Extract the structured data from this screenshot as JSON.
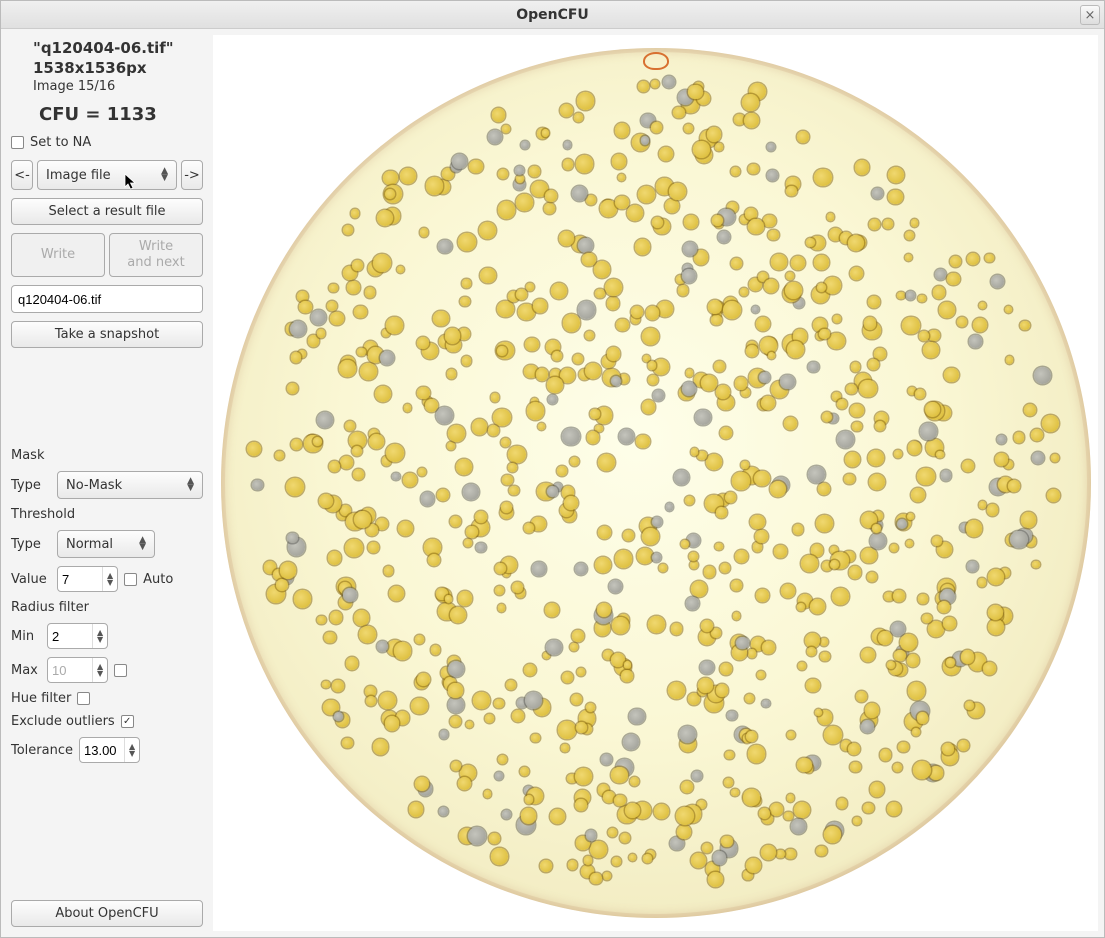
{
  "window": {
    "title": "OpenCFU",
    "close_icon": "×"
  },
  "info": {
    "filename": "\"q120404-06.tif\"",
    "dimensions": "1538x1536px",
    "image_count": "Image 15/16",
    "cfu": "CFU = 1133"
  },
  "set_na": {
    "label": "Set to NA",
    "checked": false
  },
  "nav": {
    "prev": "<-",
    "next": "->",
    "combo_label": "Image file"
  },
  "result_file_btn": "Select a result file",
  "write_btn": "Write",
  "write_next_btn_l1": "Write",
  "write_next_btn_l2": "and next",
  "filename_input": "q120404-06.tif",
  "snapshot_btn": "Take a snapshot",
  "mask": {
    "section": "Mask",
    "type_label": "Type",
    "type_value": "No-Mask"
  },
  "threshold": {
    "section": "Threshold",
    "type_label": "Type",
    "type_value": "Normal",
    "value_label": "Value",
    "value": "7",
    "auto_label": "Auto",
    "auto_checked": false
  },
  "radius": {
    "section": "Radius filter",
    "min_label": "Min",
    "min_value": "2",
    "max_label": "Max",
    "max_value": "10",
    "max_enabled": false,
    "max_check": false
  },
  "hue": {
    "label": "Hue filter",
    "checked": false
  },
  "outliers": {
    "label": "Exclude outliers",
    "checked": true
  },
  "tolerance": {
    "label": "Tolerance",
    "value": "13.00"
  },
  "about_btn": "About OpenCFU"
}
